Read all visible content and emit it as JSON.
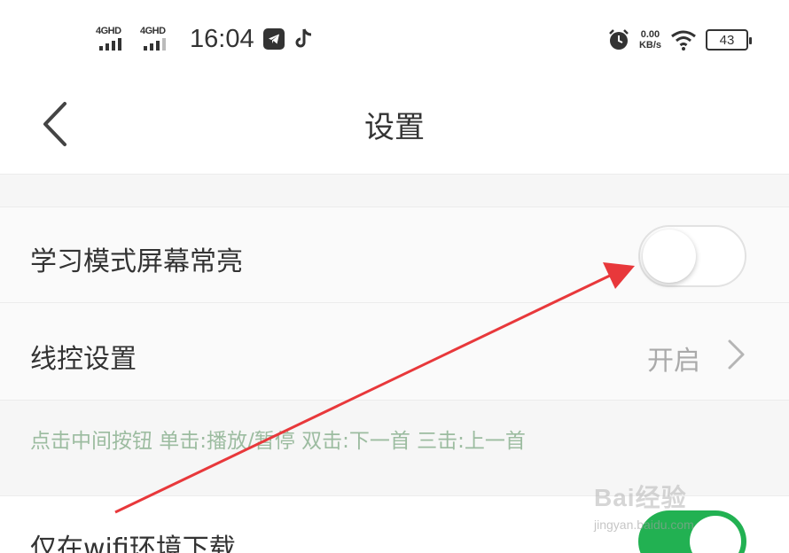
{
  "status_bar": {
    "network_1": "4GHD",
    "network_2": "4GHD",
    "time": "16:04",
    "speed_value": "0.00",
    "speed_unit": "KB/s",
    "battery": "43",
    "icons": [
      "telegram-icon",
      "tiktok-icon",
      "alarm-icon",
      "wifi-icon",
      "battery-icon"
    ]
  },
  "nav": {
    "title": "设置",
    "back_icon": "chevron-left-icon"
  },
  "settings": {
    "screen_on": {
      "label": "学习模式屏幕常亮",
      "enabled": false
    },
    "wire_control": {
      "label": "线控设置",
      "value": "开启"
    },
    "hint": "点击中间按钮 单击:播放/暂停 双击:下一首 三击:上一首",
    "wifi_only": {
      "label": "仅在wifi环境下载",
      "enabled": true
    }
  },
  "watermark": {
    "main": "Bai经验",
    "sub": "jingyan.baidu.com"
  },
  "colors": {
    "accent_green": "#22b152",
    "hint_green": "#9cbca0",
    "arrow_red": "#e8383b"
  }
}
